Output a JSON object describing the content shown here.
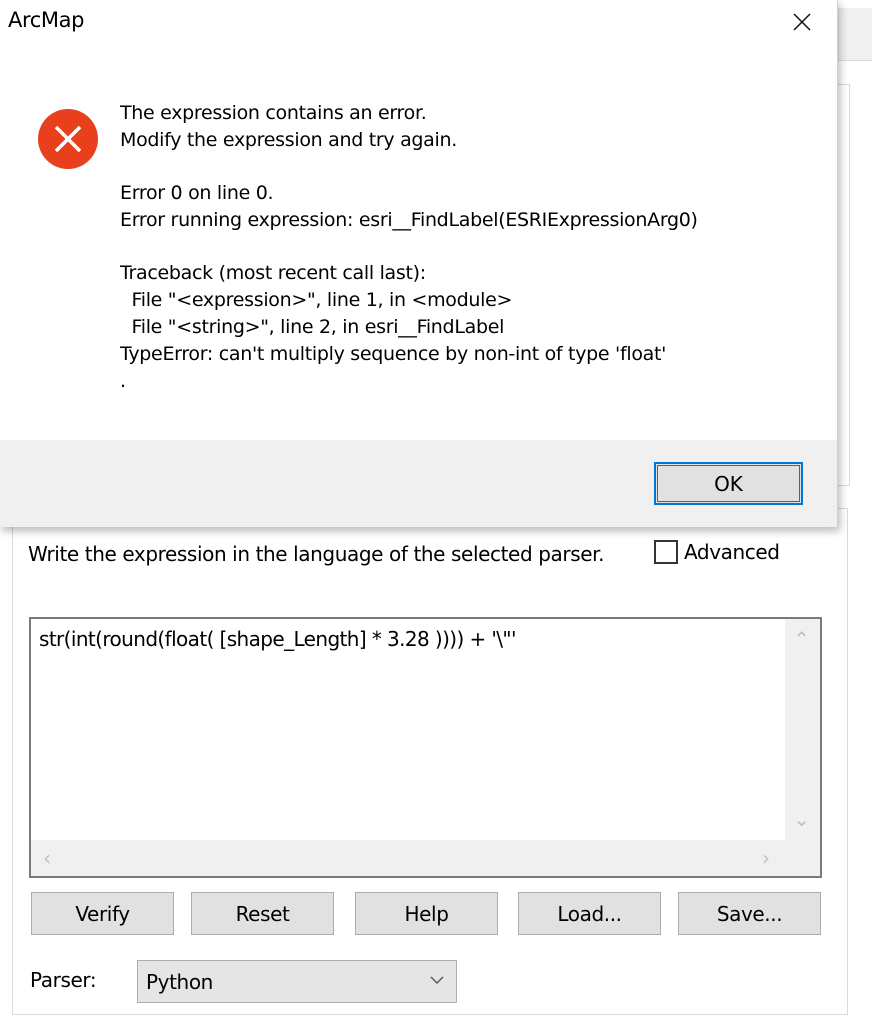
{
  "error_dialog": {
    "title": "ArcMap",
    "close_label": "Close",
    "icon": "error-icon",
    "message_lines": [
      "The expression contains an error.",
      "Modify the expression and try again.",
      "",
      "Error 0 on line 0.",
      "Error running expression: esri__FindLabel(ESRIExpressionArg0)",
      "",
      "Traceback (most recent call last):",
      "  File \"<expression>\", line 1, in <module>",
      "  File \"<string>\", line 2, in esri__FindLabel",
      "TypeError: can't multiply sequence by non-int of type 'float'",
      "."
    ],
    "ok_label": "OK",
    "accent_color": "#0078d7",
    "icon_color": "#e8401c"
  },
  "expression_dialog": {
    "hint": "Write the expression in the language of the selected parser.",
    "advanced_label": "Advanced",
    "advanced_checked": false,
    "expression": "str(int(round(float( [shape_Length] * 3.28 )))) + '\\\"'",
    "buttons": {
      "verify": "Verify",
      "reset": "Reset",
      "help": "Help",
      "load": "Load...",
      "save": "Save..."
    },
    "parser_label": "Parser:",
    "parser_value": "Python"
  }
}
